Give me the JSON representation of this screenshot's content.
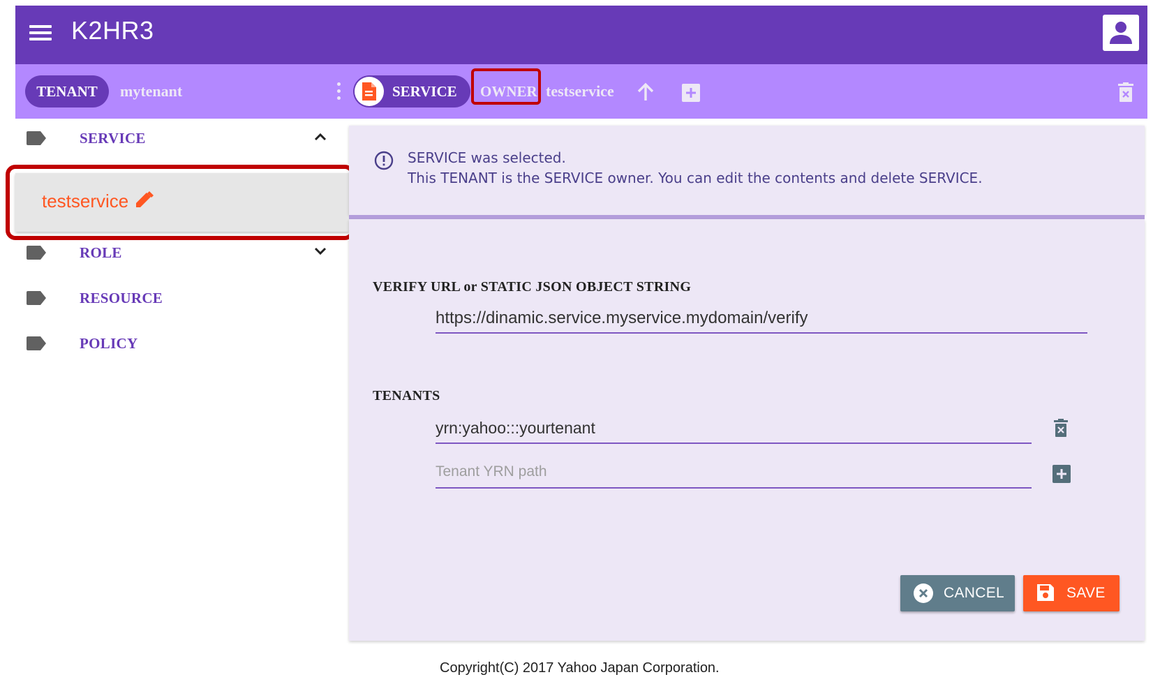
{
  "app": {
    "title": "K2HR3"
  },
  "toolbar": {
    "tenant_chip": "TENANT",
    "tenant_name": "mytenant",
    "service_chip": "SERVICE",
    "owner_label": "OWNER",
    "service_name": "testservice"
  },
  "sidebar": {
    "items": [
      {
        "label": "SERVICE",
        "expanded": true,
        "children": [
          {
            "label": "testservice"
          }
        ]
      },
      {
        "label": "ROLE",
        "expanded": false
      },
      {
        "label": "RESOURCE"
      },
      {
        "label": "POLICY"
      }
    ]
  },
  "info": {
    "line1": "SERVICE was selected.",
    "line2": "This TENANT is the SERVICE owner. You can edit the contents and delete SERVICE."
  },
  "form": {
    "verify_label": "VERIFY URL or STATIC JSON OBJECT STRING",
    "verify_value": "https://dinamic.service.myservice.mydomain/verify",
    "tenants_label": "TENANTS",
    "tenants": [
      "yrn:yahoo:::yourtenant"
    ],
    "tenant_placeholder": "Tenant YRN path",
    "cancel_label": "CANCEL",
    "save_label": "SAVE"
  },
  "footer": {
    "copyright": "Copyright(C) 2017 Yahoo Japan Corporation."
  },
  "icons": {
    "menu": "menu-icon",
    "account": "account-icon",
    "more": "more-vert-icon",
    "service_avatar": "document-icon",
    "up": "arrow-up-icon",
    "add": "add-box-icon",
    "delete": "delete-forever-icon",
    "tag": "label-icon",
    "pencil": "edit-icon",
    "info": "info-outline-icon",
    "cancel": "cancel-icon",
    "save": "save-icon"
  },
  "colors": {
    "primary": "#673ab7",
    "toolbar": "#b388ff",
    "accent": "#ff5722",
    "card": "#ede7f6",
    "cancel": "#607d8b",
    "highlight": "#c00000"
  }
}
